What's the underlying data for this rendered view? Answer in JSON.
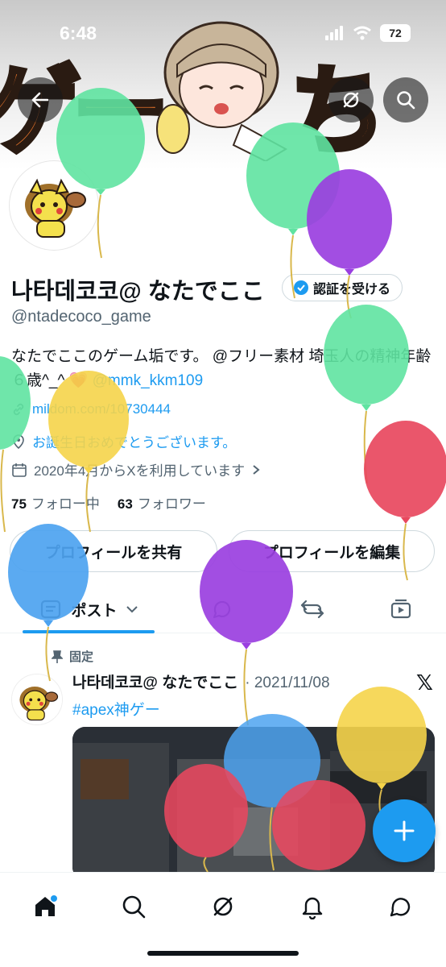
{
  "status_bar": {
    "time": "6:48",
    "battery": "72"
  },
  "banner": {
    "left_text": "ゲー",
    "right_text": "ちず"
  },
  "profile": {
    "display_name": "나타데코코@ なたでここ",
    "verify_label": "認証を受ける",
    "handle": "@ntadecoco_game",
    "bio_text": "なたでここのゲーム垢です。 @フリー素材 埼玉人の精神年齢６歳^_^",
    "bio_heart": "💗",
    "bio_mention": "@mmk_kkm109",
    "website": "mildom.com/10730444",
    "birthday": "お誕生日おめでとうございます。",
    "joined": "2020年4月からXを利用しています",
    "following_count": "75",
    "following_label": "フォロー中",
    "followers_count": "63",
    "followers_label": "フォロワー",
    "share_button": "プロフィールを共有",
    "edit_button": "プロフィールを編集"
  },
  "tabs": {
    "posts_label": "ポスト"
  },
  "pinned_post": {
    "pinned_label": "固定",
    "author": "나타데코코@ なたでここ",
    "date": "· 2021/11/08",
    "hashtag": "#apex神ゲー",
    "x_mark": "𝕏"
  },
  "colors": {
    "accent": "#1d9bf0",
    "text": "#0f1419",
    "muted": "#536471"
  }
}
